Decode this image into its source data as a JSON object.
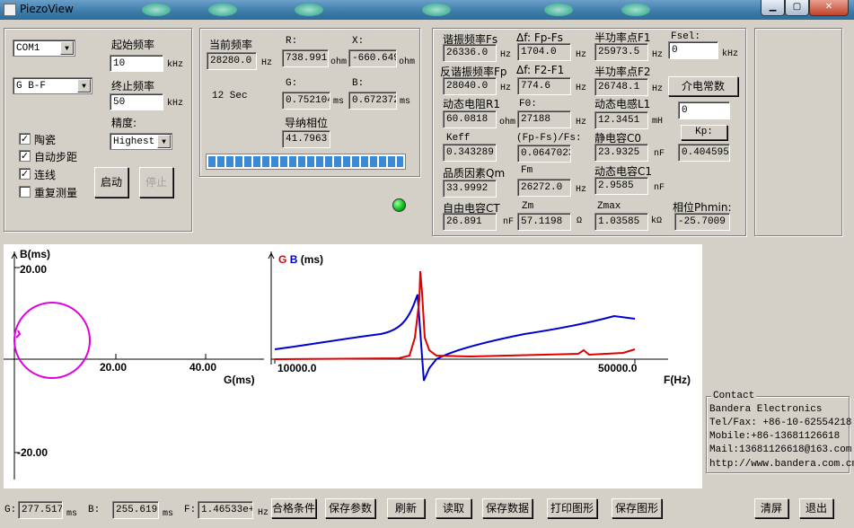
{
  "window": {
    "title": "PiezoView",
    "min": "▁",
    "max": "▢",
    "close": "✕"
  },
  "left": {
    "port": "COM1",
    "mode": "G B-F",
    "start_label": "起始频率",
    "start_value": "10",
    "stop_label": "终止频率",
    "stop_value": "50",
    "unit_khz": "kHz",
    "precision_label": "精度:",
    "precision_value": "Highest",
    "checks": [
      {
        "label": "陶瓷",
        "checked": "✓"
      },
      {
        "label": "自动步距",
        "checked": "✓"
      },
      {
        "label": "连线",
        "checked": "✓"
      },
      {
        "label": "重复测量",
        "checked": ""
      }
    ],
    "start_button": "启动",
    "stop_button": "停止"
  },
  "meas": {
    "cur_freq_label": "当前频率",
    "cur_freq": "28280.0",
    "hz": "Hz",
    "r_label": "R:",
    "r_value": "738.991",
    "ohm": "ohm",
    "x_label": "X:",
    "x_value": "-660.649",
    "time": "12 Sec",
    "g_label": "G:",
    "g_value": "0.752104",
    "ms": "ms",
    "b_label": "B:",
    "b_value": "0.672372",
    "phase_label": "导纳相位",
    "phase_value": "41.7963",
    "progress": 1.0
  },
  "params": {
    "fs_label": "谐振频率Fs",
    "fs": "26336.0",
    "df_label": "Δf: Fp-Fs",
    "df": "1704.0",
    "f1_label": "半功率点F1",
    "f1": "25973.5",
    "fsel_label": "Fsel:",
    "fsel": "0",
    "fp_label": "反谐振频率Fp",
    "fp": "28040.0",
    "df2_label": "Δf: F2-F1",
    "df2": "774.6",
    "f2_label": "半功率点F2",
    "f2": "26748.1",
    "dielectric_button": "介电常数",
    "dielectric": "0",
    "r1_label": "动态电阻R1",
    "r1": "60.0818",
    "f0_label": "F0:",
    "f0": "27188",
    "l1_label": "动态电感L1",
    "l1": "12.3451",
    "kp_button": "Kp:",
    "kp": "0.404595",
    "keff_label": "Keff",
    "keff": "0.343289",
    "ratio_label": "(Fp-Fs)/Fs:",
    "ratio": "0.0647023",
    "c0_label": "静电容C0",
    "c0": "23.9325",
    "qm_label": "品质因素Qm",
    "qm": "33.9992",
    "fm_label": "Fm",
    "fm": "26272.0",
    "c1_label": "动态电容C1",
    "c1": "2.9585",
    "ct_label": "自由电容CT",
    "ct": "26.891",
    "zm_label": "Zm",
    "zm": "57.1198",
    "zmax_label": "Zmax",
    "zmax": "1.03585",
    "phmin_label": "相位Phmin:",
    "phmin": "-25.7009",
    "u_hz": "Hz",
    "u_ohm": "ohm",
    "u_mh": "mH",
    "u_nf": "nF",
    "u_omega": "Ω",
    "u_kohm": "kΩ"
  },
  "plot": {
    "left_ylabel": "B(ms)",
    "left_y_top": "20.00",
    "left_y_bottom": "-20.00",
    "left_x1": "20.00",
    "left_x2": "40.00",
    "left_xlabel": "G(ms)",
    "right_title_g": "G",
    "right_title_b": "B",
    "right_title_unit": "(ms)",
    "right_x1": "10000.0",
    "right_x2": "50000.0",
    "right_xlabel": "F(Hz)",
    "colors": {
      "g": "#e00000",
      "b": "#0000d0",
      "circle": "#e000e0"
    }
  },
  "contact": {
    "title": "Contact",
    "lines": [
      "Bandera Electronics",
      "Tel/Fax: +86-10-62554218",
      "Mobile:+86-13681126618",
      "Mail:13681126618@163.com",
      "http://www.bandera.com.cn"
    ]
  },
  "bottom": {
    "g_label": "G:",
    "g_value": "277.517",
    "ms": "ms",
    "b_label": "B:",
    "b_value": "255.619",
    "f_label": "F:",
    "f_value": "1.46533e+06",
    "hz": "Hz",
    "buttons": [
      "合格条件",
      "保存参数",
      "刷新",
      "读取",
      "保存数据",
      "打印图形",
      "保存图形"
    ],
    "clear": "清屏",
    "exit": "退出"
  }
}
